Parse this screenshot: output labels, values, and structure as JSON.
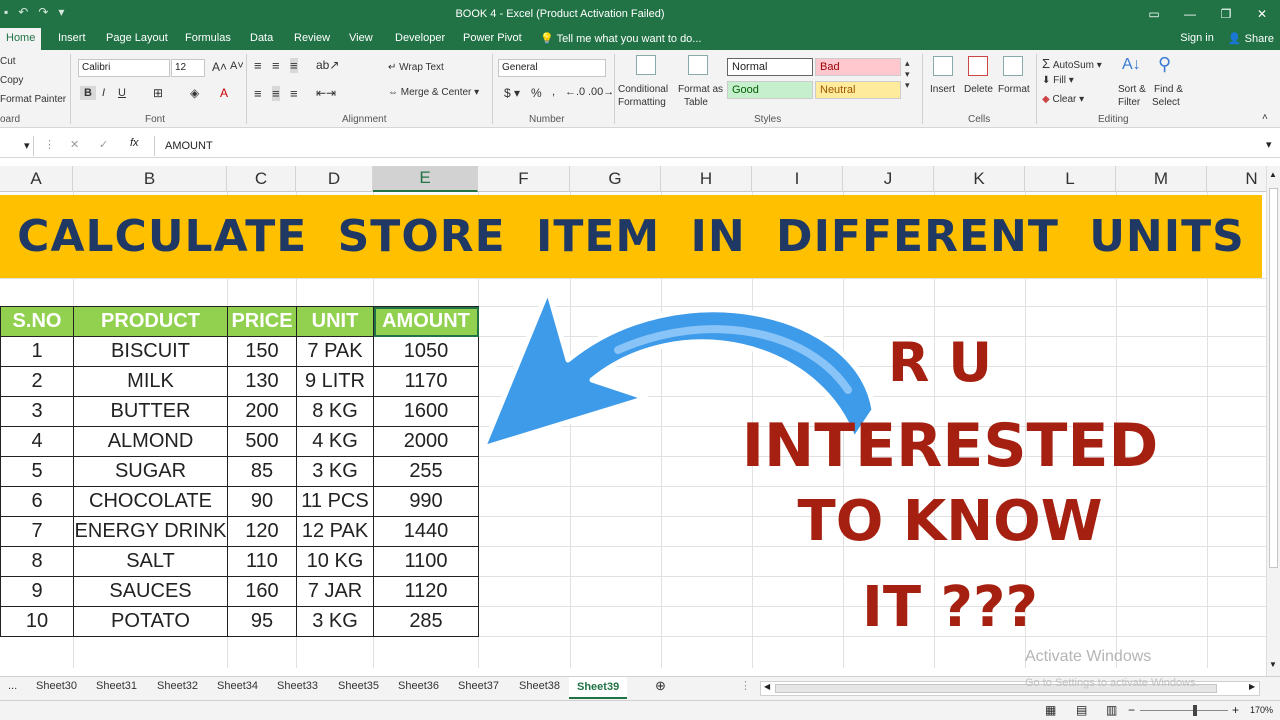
{
  "window": {
    "title": "BOOK 4 - Excel (Product Activation Failed)"
  },
  "tabs": [
    "Home",
    "Insert",
    "Page Layout",
    "Formulas",
    "Data",
    "Review",
    "View",
    "Developer",
    "Power Pivot"
  ],
  "tell_me": "Tell me what you want to do...",
  "signin": "Sign in",
  "share": "Share",
  "ribbon": {
    "clipboard": {
      "cut": "Cut",
      "copy": "Copy",
      "format_painter": "Format Painter",
      "label": "oard"
    },
    "font": {
      "name": "Calibri",
      "size": "12",
      "label": "Font"
    },
    "alignment": {
      "wrap": "Wrap Text",
      "merge": "Merge & Center",
      "label": "Alignment"
    },
    "number": {
      "format": "General",
      "label": "Number"
    },
    "styles": {
      "cond": "Conditional",
      "cond2": "Formatting",
      "fmt_table": "Format as",
      "fmt_table2": "Table",
      "normal": "Normal",
      "bad": "Bad",
      "good": "Good",
      "neutral": "Neutral",
      "label": "Styles"
    },
    "cells": {
      "insert": "Insert",
      "delete": "Delete",
      "format": "Format",
      "label": "Cells"
    },
    "editing": {
      "autosum": "AutoSum",
      "fill": "Fill",
      "clear": "Clear",
      "sort": "Sort &",
      "sort2": "Filter",
      "find": "Find &",
      "find2": "Select",
      "label": "Editing"
    }
  },
  "formula_bar": {
    "fx": "fx",
    "value": "AMOUNT"
  },
  "columns": [
    "A",
    "B",
    "C",
    "D",
    "E",
    "F",
    "G",
    "H",
    "I",
    "J",
    "K",
    "L",
    "M",
    "N"
  ],
  "banner": "CALCULATE STORE ITEM IN DIFFERENT UNITS",
  "table": {
    "headers": [
      "S.NO",
      "PRODUCT",
      "PRICE",
      "UNIT",
      "AMOUNT"
    ],
    "rows": [
      [
        "1",
        "BISCUIT",
        "150",
        "7 PAK",
        "1050"
      ],
      [
        "2",
        "MILK",
        "130",
        "9 LITR",
        "1170"
      ],
      [
        "3",
        "BUTTER",
        "200",
        "8 KG",
        "1600"
      ],
      [
        "4",
        "ALMOND",
        "500",
        "4 KG",
        "2000"
      ],
      [
        "5",
        "SUGAR",
        "85",
        "3 KG",
        "255"
      ],
      [
        "6",
        "CHOCOLATE",
        "90",
        "11 PCS",
        "990"
      ],
      [
        "7",
        "ENERGY DRINK",
        "120",
        "12 PAK",
        "1440"
      ],
      [
        "8",
        "SALT",
        "110",
        "10 KG",
        "1100"
      ],
      [
        "9",
        "SAUCES",
        "160",
        "7 JAR",
        "1120"
      ],
      [
        "10",
        "POTATO",
        "95",
        "3 KG",
        "285"
      ]
    ]
  },
  "overlay": {
    "line1": "R U",
    "line2": "INTERESTED",
    "line3": "TO KNOW",
    "line4": "IT ???"
  },
  "sheets": [
    "...",
    "Sheet30",
    "Sheet31",
    "Sheet32",
    "Sheet34",
    "Sheet33",
    "Sheet35",
    "Sheet36",
    "Sheet37",
    "Sheet38",
    "Sheet39"
  ],
  "active_sheet": "Sheet39",
  "watermark": {
    "line1": "Activate Windows",
    "line2": "Go to Settings to activate Windows."
  },
  "zoom": "170%",
  "colors": {
    "excel_green": "#217346",
    "banner": "#ffc000",
    "header_green": "#92d050",
    "arrow": "#3d9be9",
    "overlay_red": "#a52010"
  }
}
